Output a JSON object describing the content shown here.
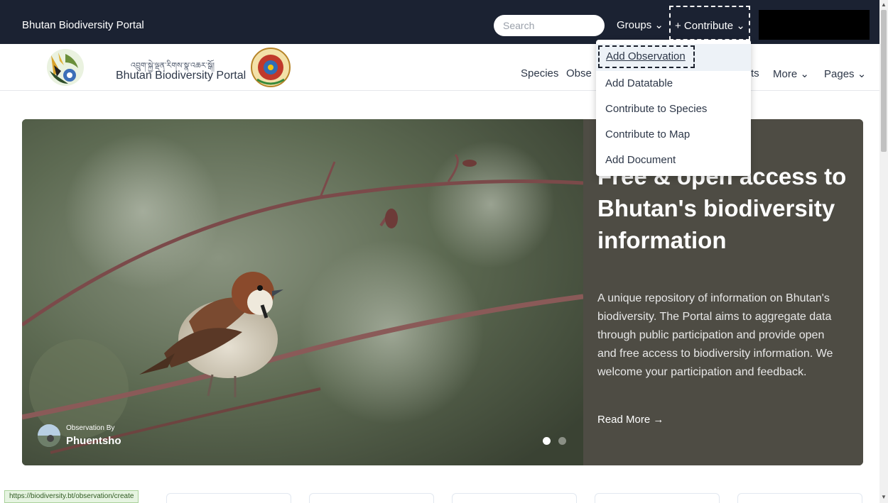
{
  "topbar": {
    "title": "Bhutan Biodiversity Portal",
    "search_placeholder": "Search",
    "groups_label": "Groups ⌄",
    "contribute_label": "+ Contribute ⌄"
  },
  "brand": {
    "tibetan_name": "འབྲུག་སྐྱེ་ལྡན་རིགས་སྣ་འཆར་སྒོ།",
    "portal_name": "Bhutan Biodiversity Portal"
  },
  "nav": {
    "species": "Species",
    "observations_partial": "Obse",
    "partial_ts": "ts",
    "more": "More ⌄",
    "pages": "Pages ⌄"
  },
  "contribute_menu": {
    "items": [
      "Add Observation",
      "Add Datatable",
      "Contribute to Species",
      "Contribute to Map",
      "Add Document"
    ]
  },
  "hero": {
    "heading": "Free & open access to Bhutan's biodiversity information",
    "description": "A unique repository of information on Bhutan's biodiversity. The Portal aims to aggregate data through public participation and provide open and free access to biodiversity information. We welcome your participation and feedback.",
    "read_more": "Read More →",
    "observation_by_label": "Observation By",
    "observer_name": "Phuentsho"
  },
  "status_bar": {
    "url": "https://biodiversity.bt/observation/create"
  },
  "colors": {
    "topbar": "#1b2232",
    "hero_panel": "#4e4c44",
    "status_green": "#e6f4e1"
  }
}
